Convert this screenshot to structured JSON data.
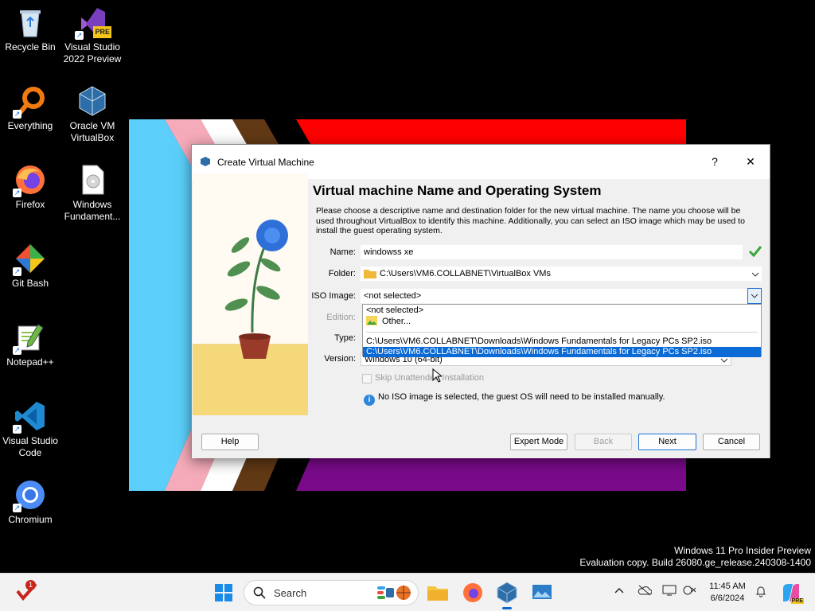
{
  "desktop": {
    "icons": [
      {
        "label": "Recycle Bin"
      },
      {
        "label": "Visual Studio 2022 Preview",
        "badge": "PRE"
      },
      {
        "label": "Everything"
      },
      {
        "label": "Oracle VM VirtualBox"
      },
      {
        "label": "Firefox"
      },
      {
        "label": "Windows Fundament..."
      },
      {
        "label": "Git Bash"
      },
      {
        "label": "Notepad++"
      },
      {
        "label": "Visual Studio Code"
      },
      {
        "label": "Chromium"
      }
    ]
  },
  "dialog": {
    "title": "Create Virtual Machine",
    "help_glyph": "?",
    "close_glyph": "✕",
    "heading": "Virtual machine Name and Operating System",
    "description": "Please choose a descriptive name and destination folder for the new virtual machine. The name you choose will be used throughout VirtualBox to identify this machine. Additionally, you can select an ISO image which may be used to install the guest operating system.",
    "fields": {
      "name_label": "Name:",
      "name_value": "windowss xe",
      "folder_label": "Folder:",
      "folder_value": "C:\\Users\\VM6.COLLABNET\\VirtualBox VMs",
      "iso_label": "ISO Image:",
      "iso_value": "<not selected>",
      "edition_label": "Edition:",
      "type_label": "Type:",
      "version_label": "Version:",
      "version_value": "Windows 10 (64-bit)"
    },
    "iso_dropdown": {
      "options": [
        "<not selected>",
        "Other...",
        "C:\\Users\\VM6.COLLABNET\\Downloads\\Windows Fundamentals for Legacy PCs SP2.iso",
        "C:\\Users\\VM6.COLLABNET\\Downloads\\Windows Fundamentals for Legacy PCs SP2.iso"
      ],
      "highlighted_index": 3
    },
    "skip_unattended_label": "Skip Unattended Installation",
    "info_message": "No ISO image is selected, the guest OS will need to be installed manually.",
    "buttons": {
      "help": "Help",
      "expert_mode": "Expert Mode",
      "back": "Back",
      "next": "Next",
      "cancel": "Cancel"
    }
  },
  "watermark": {
    "line1": "Windows 11 Pro Insider Preview",
    "line2": "Evaluation copy. Build 26080.ge_release.240308-1400"
  },
  "taskbar": {
    "search_placeholder": "Search",
    "notification_badge": "1",
    "copilot_badge": "PRE",
    "time": "11:45 AM",
    "date": "6/6/2024"
  },
  "colors": {
    "accent": "#0a6ad6",
    "wallpaper_purple": "#7a0a8a",
    "wallpaper_red": "#ff0000"
  }
}
